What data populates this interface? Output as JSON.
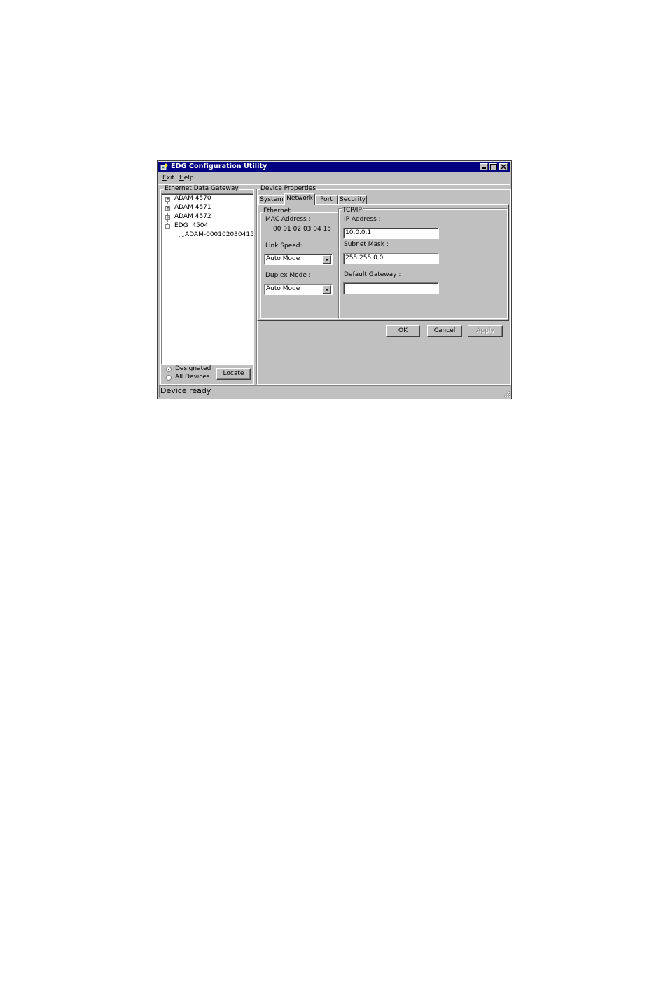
{
  "window": {
    "title": "EDG Configuration Utility",
    "controls": {
      "minimize": "_",
      "maximize": "□",
      "close": "✕"
    }
  },
  "menu": [
    {
      "label": "Exit",
      "underline": "E",
      "rest": "xit"
    },
    {
      "label": "Help",
      "underline": "H",
      "rest": "elp"
    }
  ],
  "left_panel": {
    "title": "Ethernet Data Gateway",
    "tree": [
      {
        "label": "ADAM 4570",
        "expander": "+"
      },
      {
        "label": "ADAM 4571",
        "expander": "+"
      },
      {
        "label": "ADAM 4572",
        "expander": "+"
      },
      {
        "label": "EDG  4504",
        "expander": "−"
      },
      {
        "label": "ADAM-000102030415",
        "expander": ""
      }
    ],
    "radio_options": [
      {
        "label": "Designated",
        "selected": true
      },
      {
        "label": "All Devices",
        "selected": false
      }
    ],
    "locate_button": "Locate"
  },
  "device_properties": {
    "title": "Device Properties",
    "tabs": [
      {
        "label": "System",
        "active": false
      },
      {
        "label": "Network",
        "active": true
      },
      {
        "label": "Port",
        "active": false
      },
      {
        "label": "Security",
        "active": false
      }
    ],
    "ethernet": {
      "title": "Ethernet",
      "mac_label": "MAC Address :",
      "mac_value": "00 01 02 03 04 15",
      "link_speed_label": "Link Speed:",
      "link_speed_value": "Auto Mode",
      "duplex_label": "Duplex Mode :",
      "duplex_value": "Auto Mode"
    },
    "tcpip": {
      "title": "TCP/IP",
      "ip_label": "IP Address :",
      "ip_value": "10.0.0.1",
      "subnet_label": "Subnet Mask :",
      "subnet_value": "255.255.0.0",
      "gateway_label": "Default Gateway :",
      "gateway_value": ""
    },
    "buttons": {
      "ok": "OK",
      "cancel": "Cancel",
      "apply": "Apply"
    }
  },
  "status": {
    "text": "Device ready"
  },
  "colors": {
    "titlebar": "#000080",
    "face": "#c0c0c0",
    "disabled_text": "#808080"
  }
}
